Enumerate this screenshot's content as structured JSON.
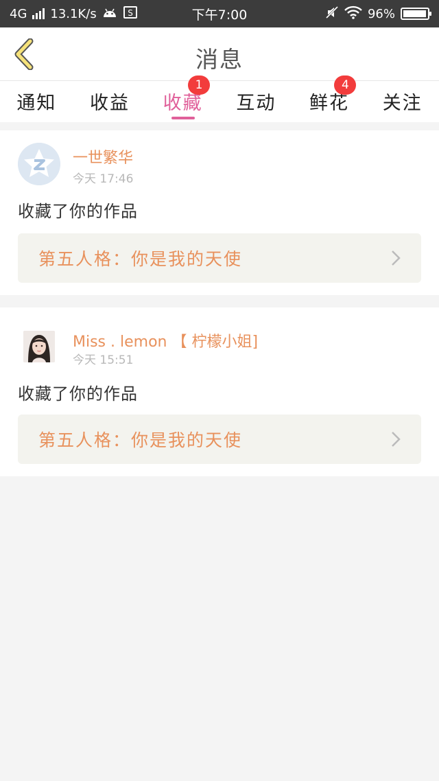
{
  "status_bar": {
    "network": "4G",
    "speed": "13.1K/s",
    "time": "下午7:00",
    "battery": "96%"
  },
  "header": {
    "title": "消息"
  },
  "tabs": [
    {
      "label": "通知",
      "badge": ""
    },
    {
      "label": "收益",
      "badge": ""
    },
    {
      "label": "收藏",
      "badge": "1"
    },
    {
      "label": "互动",
      "badge": ""
    },
    {
      "label": "鲜花",
      "badge": "4"
    },
    {
      "label": "关注",
      "badge": ""
    }
  ],
  "messages": [
    {
      "username": "一世繁华",
      "time": "今天 17:46",
      "action": "收藏了你的作品",
      "work_title": "第五人格：你是我的天使"
    },
    {
      "username": "Miss . lemon 【 柠檬小姐]",
      "time": "今天 15:51",
      "action": "收藏了你的作品",
      "work_title": "第五人格：你是我的天使"
    }
  ],
  "colors": {
    "accent": "#e0609a",
    "username": "#e8915c",
    "badge": "#f23c3c"
  }
}
